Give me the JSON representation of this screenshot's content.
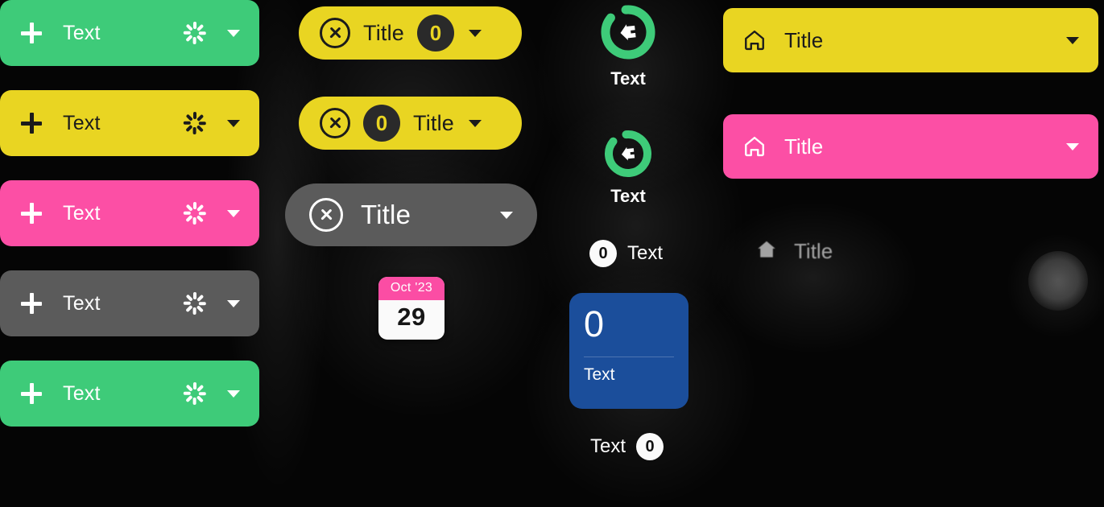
{
  "palette": {
    "background": "#050505",
    "green": "#3ECB79",
    "yellow": "#E9D522",
    "pink": "#FC4FA5",
    "gray": "#5B5B5B",
    "blue": "#1B4E9B",
    "badge_dark": "#2A2A2A",
    "badge_light": "#FAFAFA",
    "white": "#FFFFFF"
  },
  "add_buttons": [
    {
      "label": "Text",
      "variant": "v-green",
      "plus_icon": "plus-icon",
      "accessory_icon": "spinner-icon",
      "caret_icon": "chevron-down-icon"
    },
    {
      "label": "Text",
      "variant": "v-yellow",
      "plus_icon": "plus-icon",
      "accessory_icon": "spinner-icon",
      "caret_icon": "chevron-down-icon"
    },
    {
      "label": "Text",
      "variant": "v-pink",
      "plus_icon": "plus-icon",
      "accessory_icon": "spinner-icon",
      "caret_icon": "chevron-down-icon"
    },
    {
      "label": "Text",
      "variant": "v-gray",
      "plus_icon": "plus-icon",
      "accessory_icon": "spinner-icon",
      "caret_icon": "chevron-down-icon"
    },
    {
      "label": "Text",
      "variant": "v-green",
      "plus_icon": "plus-icon",
      "accessory_icon": "spinner-icon",
      "caret_icon": "chevron-down-icon"
    }
  ],
  "chips": [
    {
      "title": "Title",
      "badge": "0",
      "variant": "v-yellow",
      "badge_position": "after",
      "close_icon": "close-circle-icon",
      "caret_icon": "chevron-down-icon"
    },
    {
      "title": "Title",
      "badge": "0",
      "variant": "v-yellow",
      "badge_position": "before",
      "close_icon": "close-circle-icon",
      "caret_icon": "chevron-down-icon"
    },
    {
      "title": "Title",
      "badge": null,
      "variant": "v-gray",
      "badge_position": "none",
      "close_icon": "close-circle-icon",
      "caret_icon": "chevron-down-icon"
    }
  ],
  "calendar": {
    "month_year": "Oct '23",
    "day": "29"
  },
  "progress_rings": [
    {
      "label": "Text",
      "percent": 88,
      "color": "#3ECB79",
      "icon": "home-icon",
      "size": 72
    },
    {
      "label": "Text",
      "percent": 88,
      "color": "#3ECB79",
      "icon": "home-icon",
      "size": 62
    }
  ],
  "badge_rows": [
    {
      "badge": "0",
      "text": "Text",
      "badge_position": "before"
    },
    {
      "badge": "0",
      "text": "Text",
      "badge_position": "after"
    }
  ],
  "stat_card": {
    "value": "0",
    "label": "Text"
  },
  "wide_bars": [
    {
      "title": "Title",
      "variant": "v-yellow",
      "icon": "home-icon",
      "caret_icon": "chevron-down-icon"
    },
    {
      "title": "Title",
      "variant": "v-pink",
      "icon": "home-icon",
      "caret_icon": "chevron-down-icon"
    }
  ],
  "ghost_items": [
    {
      "title": "Title",
      "icon": "home-icon"
    }
  ]
}
